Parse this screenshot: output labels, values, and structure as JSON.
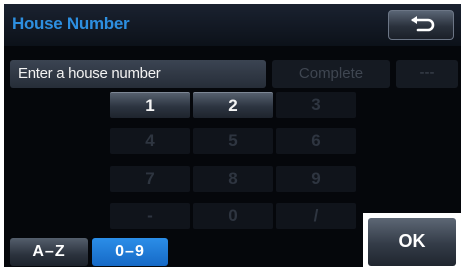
{
  "header": {
    "title": "House Number",
    "back_icon": "return-arrow-icon",
    "accent_color": "#2d8fe0"
  },
  "input": {
    "placeholder": "Enter a house number",
    "complete_label": "Complete",
    "delete_label": "---"
  },
  "keypad": {
    "keys": [
      {
        "label": "1",
        "enabled": true
      },
      {
        "label": "2",
        "enabled": true
      },
      {
        "label": "3",
        "enabled": false
      },
      {
        "label": "4",
        "enabled": false
      },
      {
        "label": "5",
        "enabled": false
      },
      {
        "label": "6",
        "enabled": false
      },
      {
        "label": "7",
        "enabled": false
      },
      {
        "label": "8",
        "enabled": false
      },
      {
        "label": "9",
        "enabled": false
      },
      {
        "label": "-",
        "enabled": false
      },
      {
        "label": "0",
        "enabled": false
      },
      {
        "label": "/",
        "enabled": false
      }
    ]
  },
  "mode": {
    "alpha_label": "A–Z",
    "numeric_label": "0–9",
    "selected": "0–9",
    "selected_color": "#1f7ad8"
  },
  "ok_label": "OK"
}
